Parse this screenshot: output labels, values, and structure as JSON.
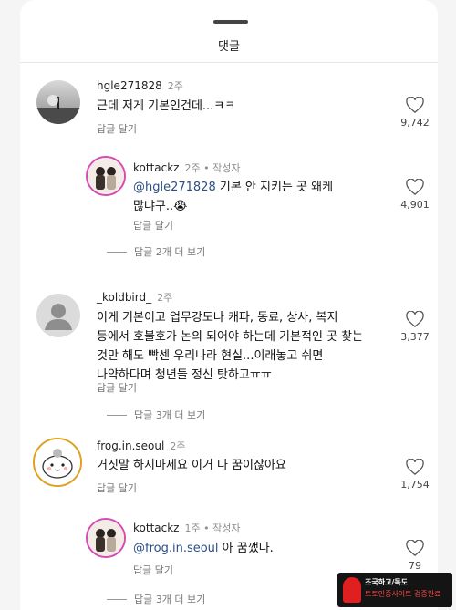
{
  "sheet": {
    "title": "댓글"
  },
  "comments": [
    {
      "username": "hgle271828",
      "meta": "2주",
      "text_lines": [
        "근데 저게 기본인건데...ㅋㅋ"
      ],
      "reply_label": "답글 달기",
      "likes": "9,742"
    },
    {
      "username": "kottackz",
      "meta": "2주 • 작성자",
      "mention": "@hgle271828",
      "text_lines": [
        " 기본 안 지키는 곳 왜케",
        "많냐구..😭"
      ],
      "reply_label": "답글 달기",
      "likes": "4,901"
    },
    {
      "view_replies": "답글 2개 더 보기"
    },
    {
      "username": "_koldbird_",
      "meta": "2주",
      "text_lines": [
        "이게 기본이고 업무강도나 캐파, 동료, 상사, 복지",
        "등에서 호불호가 논의 되어야 하는데 기본적인 곳 찾는",
        "것만 해도 빡센 우리나라 현실...이래놓고 쉬면",
        "나약하다며 청년들 정신 탓하고ㅠㅠ"
      ],
      "reply_label": "답글 달기",
      "likes": "3,377"
    },
    {
      "view_replies": "답글 3개 더 보기"
    },
    {
      "username": "frog.in.seoul",
      "meta": "2주",
      "text_lines": [
        "거짓말 하지마세요 이거 다 꿈이잖아요"
      ],
      "reply_label": "답글 달기",
      "likes": "1,754"
    },
    {
      "username": "kottackz",
      "meta": "1주 • 작성자",
      "mention": "@frog.in.seoul",
      "text_lines": [
        " 아 꿈깼다."
      ],
      "reply_label": "답글 달기",
      "likes": "79"
    },
    {
      "view_replies": "답글 3개 더 보기"
    }
  ],
  "watermark": {
    "line1": "조국하고/독도",
    "line2": "토토인증사이트 검증완료"
  },
  "colors": {
    "mention": "#2a4e87",
    "secondary_text": "#777777"
  }
}
